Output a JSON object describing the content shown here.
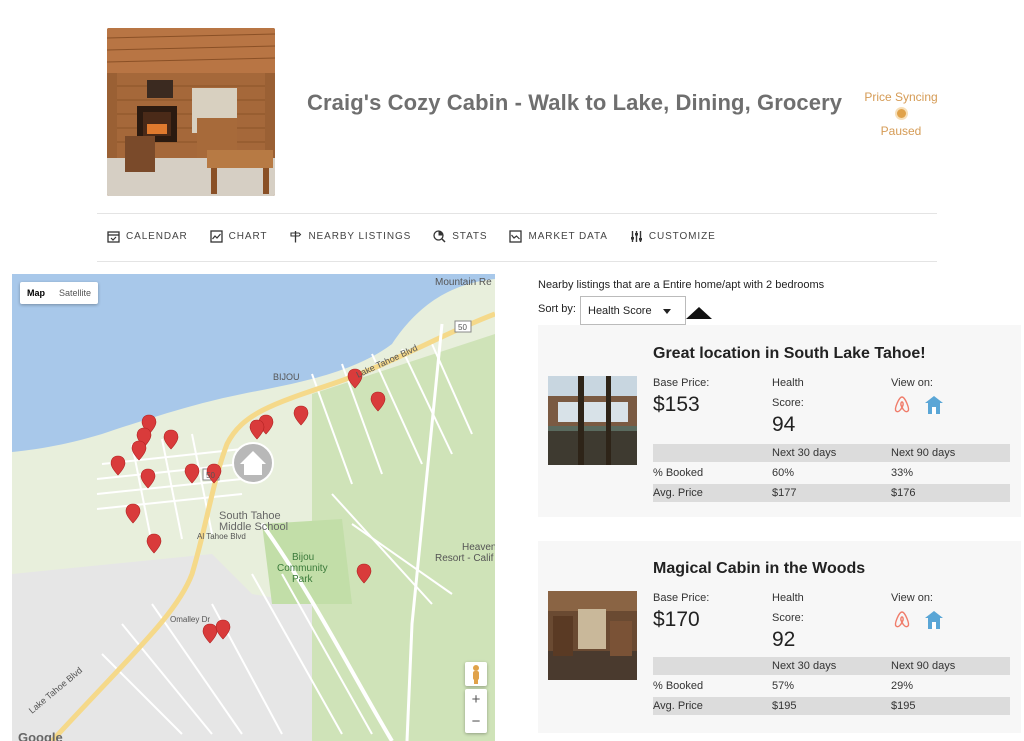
{
  "listing": {
    "title": "Craig's Cozy Cabin - Walk to Lake, Dining, Grocery",
    "subtitle": "",
    "sync_status": "Price Syncing",
    "sync_state": "Paused",
    "accent": "#d59b55"
  },
  "nav": [
    {
      "label": "CALENDAR",
      "icon": "calendar-icon"
    },
    {
      "label": "CHART",
      "icon": "chart-icon"
    },
    {
      "label": "NEARBY LISTINGS",
      "icon": "signpost-icon"
    },
    {
      "label": "STATS",
      "icon": "stats-icon"
    },
    {
      "label": "MARKET DATA",
      "icon": "market-icon"
    },
    {
      "label": "CUSTOMIZE",
      "icon": "sliders-icon"
    }
  ],
  "map": {
    "tab_map": "Map",
    "tab_satellite": "Satellite",
    "zoom_in": "+",
    "zoom_out": "−",
    "attribution": "Google",
    "labels": {
      "mountain": "Mountain Re",
      "bijou": "BIJOU",
      "south_tahoe_1": "South Tahoe",
      "south_tahoe_2": "Middle School",
      "park_1": "Bijou",
      "park_2": "Community",
      "park_3": "Park",
      "heaven_1": "Heaven",
      "heaven_2": "Resort - Calif",
      "lake_tahoe_blvd": "Lake Tahoe Blvd",
      "lake_tahoe_blvd_2": "Lake Tahoe Blvd",
      "al_tahoe": "Al Tahoe Blvd",
      "omalley": "Omalley Dr",
      "route": "50"
    }
  },
  "nearby": {
    "description": "Nearby listings that are a Entire home/apt with 2 bedrooms",
    "sort_label": "Sort by:",
    "sort_value": "Health Score"
  },
  "cards": [
    {
      "title": "Great location in South Lake Tahoe!",
      "base_price_label": "Base Price:",
      "base_price": "$153",
      "health_label_1": "Health",
      "health_label_2": "Score:",
      "health_score": "94",
      "view_on": "View on:",
      "col_30": "Next 30 days",
      "col_90": "Next 90 days",
      "booked_label": "% Booked",
      "booked_30": "60%",
      "booked_90": "33%",
      "avg_label": "Avg. Price",
      "avg_30": "$177",
      "avg_90": "$176"
    },
    {
      "title": "Magical Cabin in the Woods",
      "base_price_label": "Base Price:",
      "base_price": "$170",
      "health_label_1": "Health",
      "health_label_2": "Score:",
      "health_score": "92",
      "view_on": "View on:",
      "col_30": "Next 30 days",
      "col_90": "Next 90 days",
      "booked_label": "% Booked",
      "booked_30": "57%",
      "booked_90": "29%",
      "avg_label": "Avg. Price",
      "avg_30": "$195",
      "avg_90": "$195"
    }
  ],
  "colors": {
    "marker": "#d93b3b",
    "water": "#a8c8ea",
    "land": "#e8efdc",
    "park": "#c5e0b0",
    "road": "#ffffff",
    "highway": "#f9e3a6",
    "airbnb": "#f07c6a",
    "homeaway": "#5aa6d6"
  }
}
